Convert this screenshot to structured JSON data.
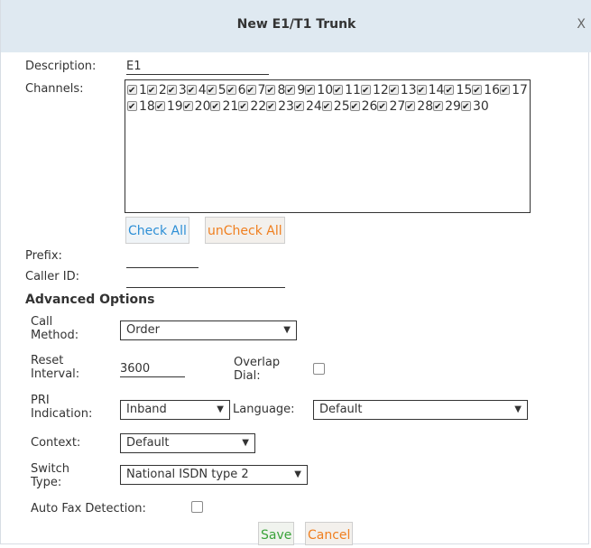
{
  "dialog": {
    "title": "New E1/T1 Trunk",
    "close": "X"
  },
  "form": {
    "description_label": "Description:",
    "description_value": "E1",
    "channels_label": "Channels:",
    "channels": [
      "1",
      "2",
      "3",
      "4",
      "5",
      "6",
      "7",
      "8",
      "9",
      "10",
      "11",
      "12",
      "13",
      "14",
      "15",
      "16",
      "17",
      "18",
      "19",
      "20",
      "21",
      "22",
      "23",
      "24",
      "25",
      "26",
      "27",
      "28",
      "29",
      "30"
    ],
    "check_all": "Check All",
    "uncheck_all": "unCheck All",
    "prefix_label": "Prefix:",
    "prefix_value": "",
    "callerid_label": "Caller ID:",
    "callerid_value": ""
  },
  "advanced": {
    "heading": "Advanced Options",
    "call_method_label_1": "Call",
    "call_method_label_2": "Method:",
    "call_method_value": "Order",
    "reset_interval_label_1": "Reset",
    "reset_interval_label_2": "Interval:",
    "reset_interval_value": "3600",
    "overlap_dial_label_1": "Overlap",
    "overlap_dial_label_2": "Dial:",
    "pri_label_1": "PRI",
    "pri_label_2": "Indication:",
    "pri_value": "Inband",
    "language_label": "Language:",
    "language_value": "Default",
    "context_label": "Context:",
    "context_value": "Default",
    "switch_label_1": "Switch",
    "switch_label_2": "Type:",
    "switch_value": "National ISDN type 2",
    "auto_fax_label": "Auto Fax Detection:"
  },
  "actions": {
    "save": "Save",
    "cancel": "Cancel"
  },
  "icons": {
    "dropdown": "chevron-down-icon",
    "checkbox": "checkbox-icon"
  }
}
